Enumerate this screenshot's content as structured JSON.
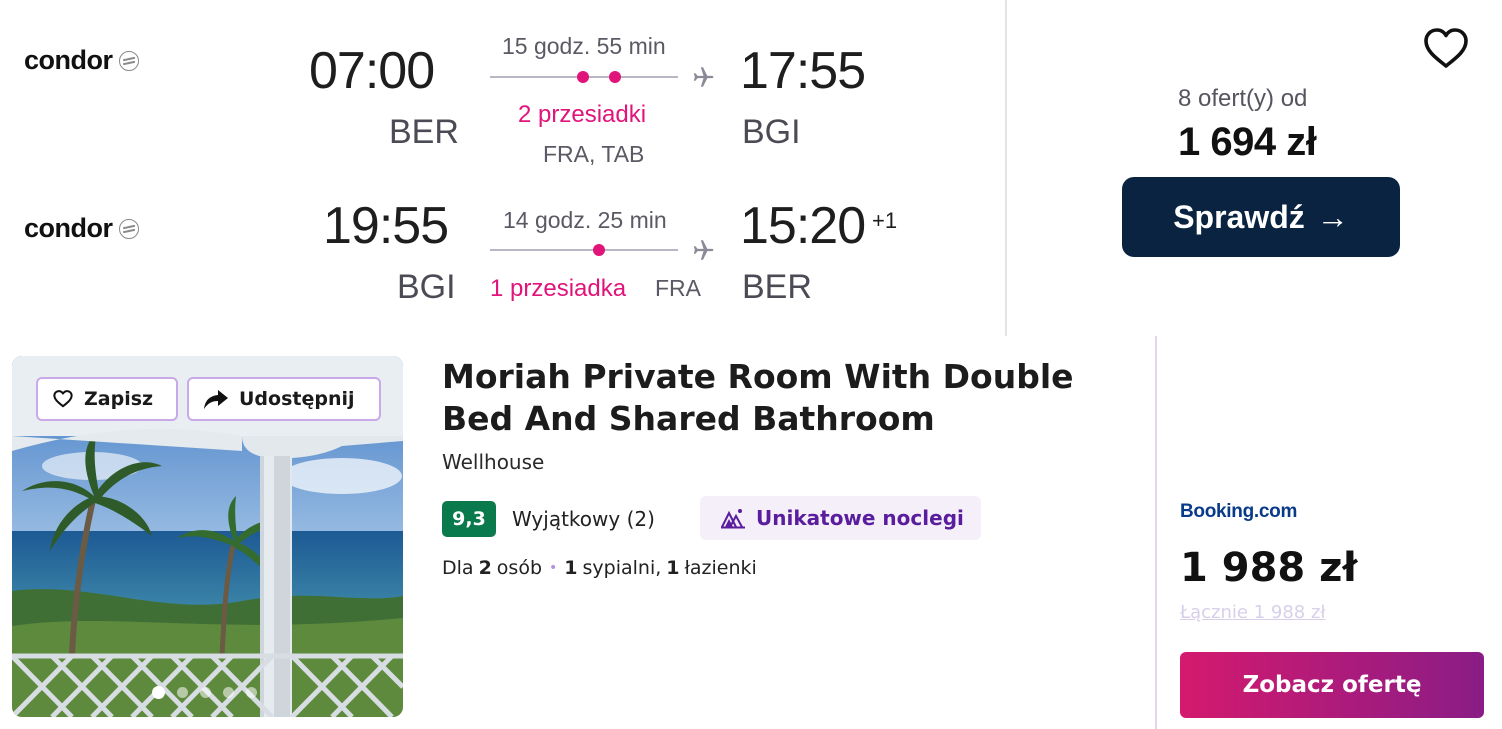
{
  "flight": {
    "outbound": {
      "airline": "condor",
      "depart_time": "07:00",
      "depart_code": "BER",
      "duration": "15 godz. 55 min",
      "stops_label": "2 przesiadki",
      "via": "FRA, TAB",
      "arrive_time": "17:55",
      "arrive_code": "BGI"
    },
    "return": {
      "airline": "condor",
      "depart_time": "19:55",
      "depart_code": "BGI",
      "duration": "14 godz. 25 min",
      "stops_label": "1 przesiadka",
      "via": "FRA",
      "arrive_time": "15:20",
      "day_offset": "+1",
      "arrive_code": "BER"
    },
    "offers_count": "8 ofert(y) od",
    "price": "1 694 zł",
    "check_button": "Sprawdź",
    "check_arrow": "→",
    "icons": {
      "favorite": "heart-outline-icon",
      "arrow": "arrow-right-icon",
      "plane": "plane-icon",
      "airline_logo": "condor-logo-icon"
    },
    "colors": {
      "stops": "#e0147a",
      "button": "#0a2340"
    }
  },
  "hotel": {
    "save_label": "Zapisz",
    "share_label": "Udostępnij",
    "title": "Moriah Private Room With Double Bed And Shared Bathroom",
    "subtitle": "Wellhouse",
    "score": "9,3",
    "score_label": "Wyjątkowy (2)",
    "unique_badge": "Unikatowe noclegi",
    "capacity": {
      "prefix": "Dla",
      "guests": "2",
      "guests_unit": "osób",
      "separator": "•",
      "bedrooms": "1",
      "bedrooms_unit": "sypialni,",
      "bathrooms": "1",
      "bathrooms_unit": "łazienki"
    },
    "provider": "Booking.com",
    "price": "1 988 zł",
    "total": "Łącznie 1 988 zł",
    "see_offer": "Zobacz ofertę",
    "photo_count": 5,
    "photo_active_index": 0,
    "colors": {
      "score_bg": "#0a7a4c",
      "badge_text": "#5a1d9e",
      "button_from": "#d41a6e",
      "button_to": "#8a1c86"
    }
  }
}
